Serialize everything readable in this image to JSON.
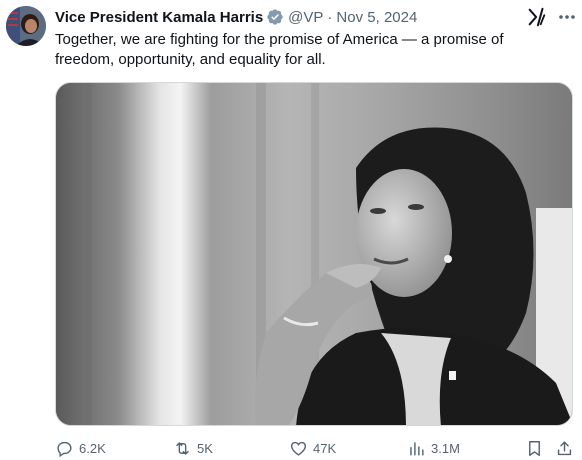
{
  "author": {
    "name": "Vice President Kamala Harris",
    "handle": "@VP",
    "separator": "·",
    "date": "Nov 5, 2024"
  },
  "tweet": {
    "text": "Together, we are fighting for the promise of America — a promise of freedom, opportunity, and equality for all."
  },
  "stats": {
    "replies": "6.2K",
    "reposts": "5K",
    "likes": "47K",
    "views": "3.1M"
  },
  "icons": {
    "verified": "verified-badge-icon",
    "grok": "grok-icon",
    "more": "more-icon",
    "reply": "reply-icon",
    "repost": "repost-icon",
    "like": "heart-icon",
    "views": "views-icon",
    "bookmark": "bookmark-icon",
    "share": "share-icon"
  },
  "colors": {
    "text": "#0f1419",
    "secondary": "#536471",
    "verified_badge": "#829aab"
  }
}
